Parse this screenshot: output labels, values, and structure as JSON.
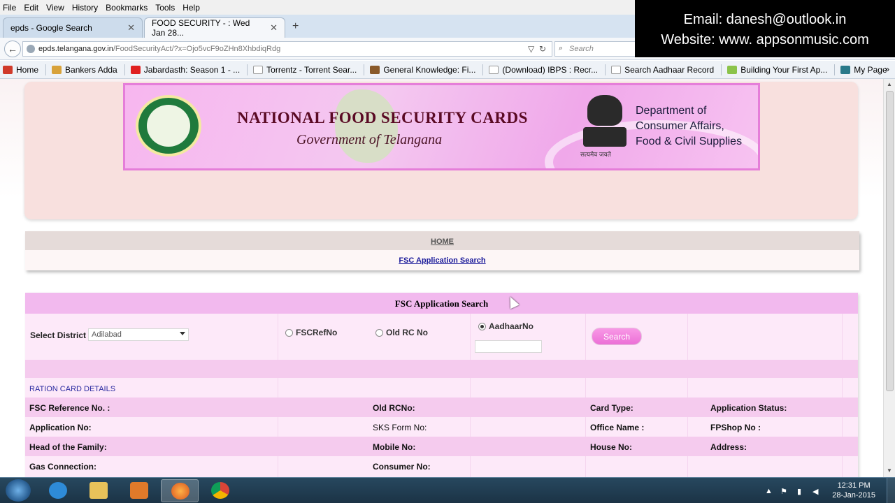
{
  "menubar": [
    "File",
    "Edit",
    "View",
    "History",
    "Bookmarks",
    "Tools",
    "Help"
  ],
  "tabs": [
    {
      "label": "epds - Google Search",
      "active": false
    },
    {
      "label": "FOOD SECURITY - : Wed Jan 28...",
      "active": true
    }
  ],
  "new_tab_label": "+",
  "address": {
    "host": "epds.telangana.gov.in",
    "path": "/FoodSecurityAct/?x=Ojo5vcF9oZHn8XhbdiqRdg"
  },
  "search": {
    "placeholder": "Search"
  },
  "overlay": {
    "email": "Email: danesh@outlook.in",
    "website": "Website: www. appsonmusic.com"
  },
  "bookmarks": [
    {
      "label": "Home",
      "color": "#d03a2a"
    },
    {
      "label": "Bankers Adda",
      "color": "#d8a23a"
    },
    {
      "label": "Jabardasth: Season 1 - ...",
      "color": "#e02020"
    },
    {
      "label": "Torrentz - Torrent Sear...",
      "color": "#ffffff"
    },
    {
      "label": "General Knowledge: Fi...",
      "color": "#8a5a2a"
    },
    {
      "label": "(Download) IBPS : Recr...",
      "color": "#ffffff"
    },
    {
      "label": "Search Aadhaar Record",
      "color": "#ffffff"
    },
    {
      "label": "Building Your First Ap...",
      "color": "#8bc34a"
    },
    {
      "label": "My Page",
      "color": "#2a7a8a"
    }
  ],
  "bookmarks_more": "»",
  "banner": {
    "title": "NATIONAL FOOD SECURITY CARDS",
    "subtitle": "Government of Telangana",
    "dept_line1": "Department of",
    "dept_line2": "Consumer Affairs,",
    "dept_line3": "Food & Civil Supplies",
    "motto": "सत्यमेव जयते"
  },
  "nav": {
    "home": "HOME",
    "fsc_search": "FSC Application Search"
  },
  "search_panel": {
    "title": "FSC Application Search",
    "district_label": "Select District :",
    "district_value": "Adilabad",
    "radio_fscref": "FSCRefNo",
    "radio_oldrc": "Old RC No",
    "radio_aadhaar": "AadhaarNo",
    "selected_radio": "AadhaarNo",
    "search_button": "Search"
  },
  "ration_card": {
    "title": "RATION CARD DETAILS",
    "fsc_ref": "FSC Reference No. :",
    "old_rc": "Old RCNo:",
    "card_type": "Card Type:",
    "app_status": "Application Status:",
    "app_no": "Application No:",
    "sks_form": "SKS Form No:",
    "office_name": "Office Name :",
    "fpshop": "FPShop No :",
    "head": "Head of the Family:",
    "mobile": "Mobile No:",
    "house": "House No:",
    "address": "Address:",
    "gas": "Gas Connection:",
    "consumer": "Consumer No:"
  },
  "taskbar": {
    "time": "12:31 PM",
    "date": "28-Jan-2015"
  }
}
